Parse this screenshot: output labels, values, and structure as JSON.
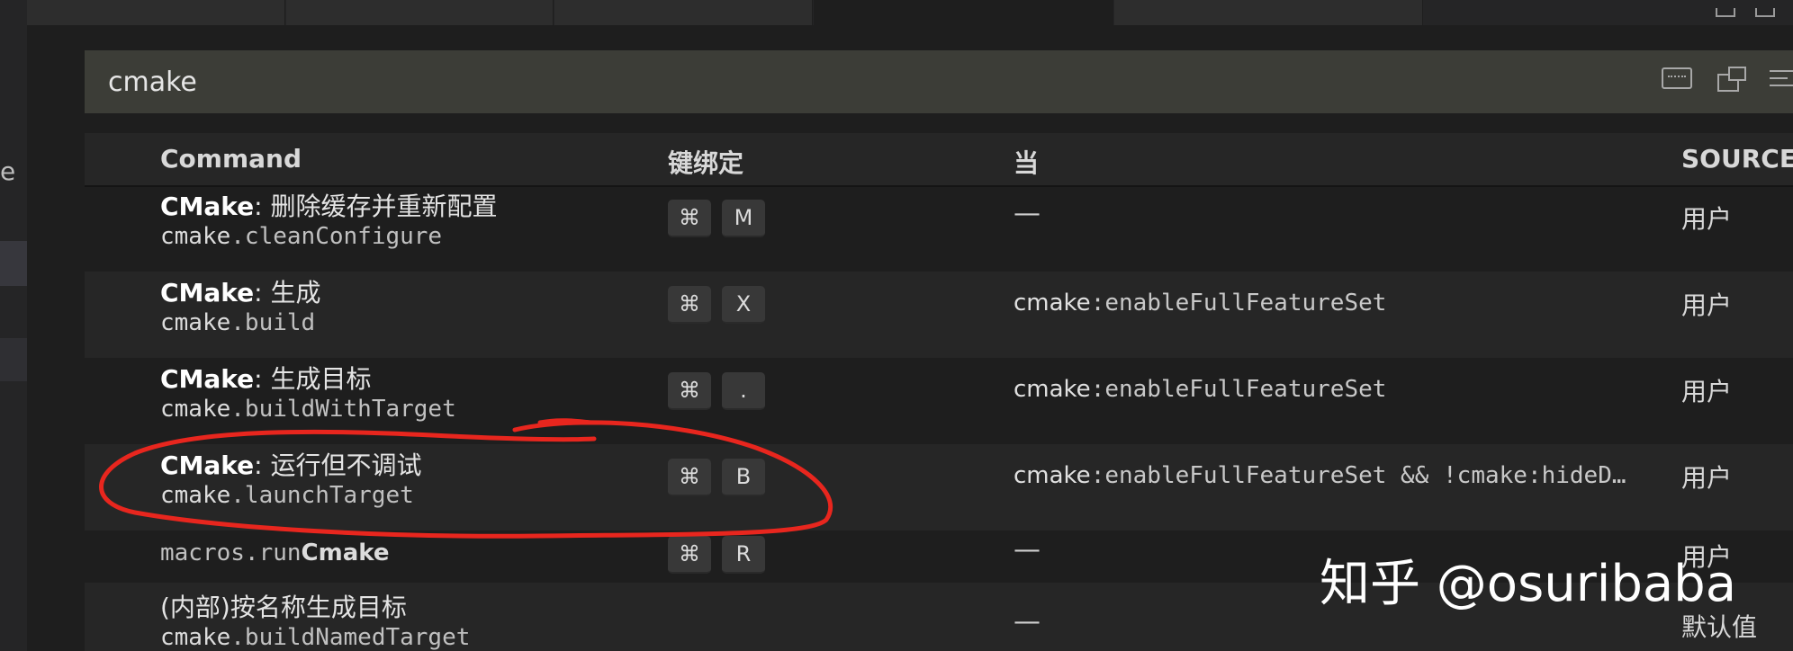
{
  "search": {
    "value": "cmake"
  },
  "table": {
    "headers": {
      "command": "Command",
      "keybinding": "键绑定",
      "when": "当",
      "source": "SOURCE"
    },
    "rows": [
      {
        "title_bold": "CMake",
        "title_rest": ": 删除缓存并重新配置",
        "id_prefix": "cmake",
        "id_rest": ".cleanConfigure",
        "keys": [
          "⌘",
          "M"
        ],
        "when_prefix": "",
        "when_rest": "—",
        "source": "用户"
      },
      {
        "title_bold": "CMake",
        "title_rest": ": 生成",
        "id_prefix": "cmake",
        "id_rest": ".build",
        "keys": [
          "⌘",
          "X"
        ],
        "when_prefix": "cmake",
        "when_rest": ":enableFullFeatureSet",
        "source": "用户"
      },
      {
        "title_bold": "CMake",
        "title_rest": ": 生成目标",
        "id_prefix": "cmake",
        "id_rest": ".buildWithTarget",
        "keys": [
          "⌘",
          "."
        ],
        "when_prefix": "cmake",
        "when_rest": ":enableFullFeatureSet",
        "source": "用户"
      },
      {
        "title_bold": "CMake",
        "title_rest": ": 运行但不调试",
        "id_prefix": "cmake",
        "id_rest": ".launchTarget",
        "keys": [
          "⌘",
          "B"
        ],
        "when_prefix": "cmake",
        "when_rest": ":enableFullFeatureSet && !cmake:hideD…",
        "source": "用户"
      },
      {
        "id_prefix": "macros.run",
        "id_rest": "Cmake",
        "keys": [
          "⌘",
          "R"
        ],
        "when_rest": "—",
        "source": "用户"
      },
      {
        "title_rest": "(内部)按名称生成目标",
        "id_prefix": "cmake",
        "id_rest": ".buildNamedTarget",
        "when_rest": "—",
        "source": "默认值"
      }
    ]
  },
  "watermark": "知乎 @osuribaba",
  "colors": {
    "annotation": "#e8261e",
    "background": "#1e1e1e",
    "search_bg": "#3c3d37"
  }
}
